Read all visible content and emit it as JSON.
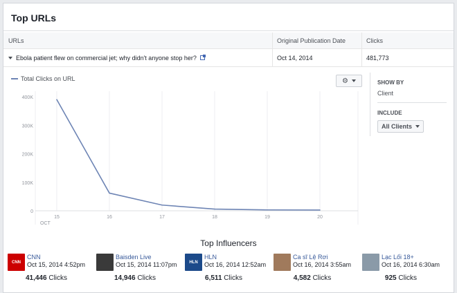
{
  "panel": {
    "title": "Top URLs"
  },
  "table": {
    "headers": {
      "url": "URLs",
      "date": "Original Publication Date",
      "clicks": "Clicks"
    },
    "row": {
      "url": "Ebola patient flew on commercial jet; why didn't anyone stop her?",
      "date": "Oct 14, 2014",
      "clicks": "481,773"
    }
  },
  "chart_data": {
    "type": "line",
    "series": [
      {
        "name": "Total Clicks on URL",
        "color": "#6d84b4",
        "values": [
          390000,
          62000,
          20000,
          6000,
          3000,
          2500
        ]
      }
    ],
    "x": [
      "15",
      "16",
      "17",
      "18",
      "19",
      "20"
    ],
    "x_month_label": "OCT",
    "y_ticks": [
      "0",
      "100K",
      "200K",
      "300K",
      "400K"
    ],
    "ylim": [
      0,
      400000
    ],
    "grid": "vertical"
  },
  "side": {
    "show_by_label": "SHOW BY",
    "show_by_value": "Client",
    "include_label": "INCLUDE",
    "include_value": "All Clients"
  },
  "influencers": {
    "title": "Top Influencers",
    "items": [
      {
        "name": "CNN",
        "date": "Oct 15, 2014 4:52pm",
        "clicks": "41,446",
        "clicks_suffix": "Clicks",
        "avatar_color": "#cc0000",
        "avatar_text": "CNN"
      },
      {
        "name": "Baisden Live",
        "date": "Oct 15, 2014 11:07pm",
        "clicks": "14,946",
        "clicks_suffix": "Clicks",
        "avatar_color": "#3a3a3a",
        "avatar_text": ""
      },
      {
        "name": "HLN",
        "date": "Oct 16, 2014 12:52am",
        "clicks": "6,511",
        "clicks_suffix": "Clicks",
        "avatar_color": "#1c4a8a",
        "avatar_text": "HLN"
      },
      {
        "name": "Ca sĩ Lệ Rơi",
        "date": "Oct 16, 2014 3:55am",
        "clicks": "4,582",
        "clicks_suffix": "Clicks",
        "avatar_color": "#a07a5c",
        "avatar_text": ""
      },
      {
        "name": "Lạc Lối 18+",
        "date": "Oct 16, 2014 6:30am",
        "clicks": "925",
        "clicks_suffix": "Clicks",
        "avatar_color": "#8a9aa8",
        "avatar_text": ""
      }
    ]
  }
}
